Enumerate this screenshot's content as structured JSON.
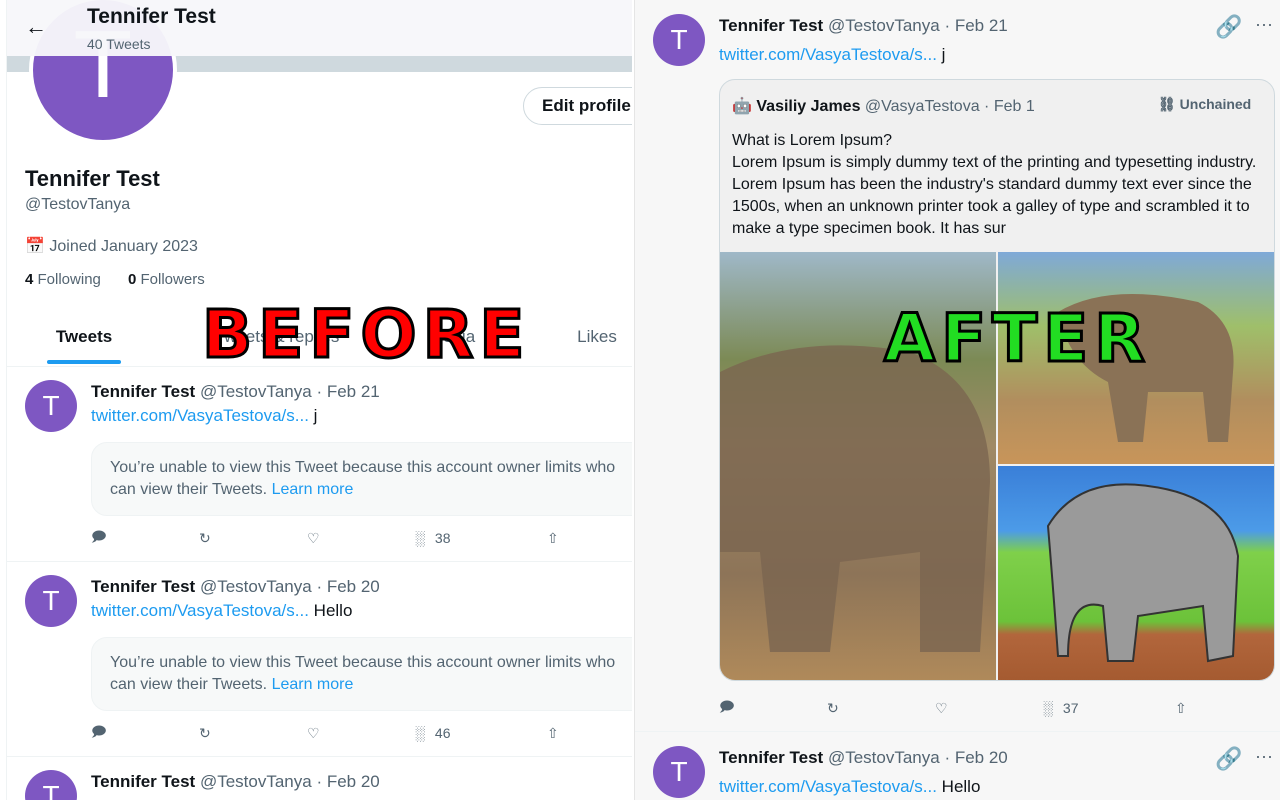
{
  "before": {
    "overlay_label": "BEFORE",
    "header": {
      "title": "Tennifer Test",
      "subtitle": "40 Tweets"
    },
    "profile": {
      "avatar_letter": "T",
      "name": "Tennifer Test",
      "handle": "@TestovTanya",
      "joined": "Joined January 2023",
      "following_count": "4",
      "following_label": "Following",
      "followers_count": "0",
      "followers_label": "Followers",
      "edit_button": "Edit profile"
    },
    "tabs": [
      {
        "label": "Tweets",
        "active": true
      },
      {
        "label": "Tweets & replies"
      },
      {
        "label": "Media"
      },
      {
        "label": "Likes"
      }
    ],
    "tweets": [
      {
        "name": "Tennifer Test",
        "handle": "@TestovTanya",
        "date": "· Feb 21",
        "link": "twitter.com/VasyaTestova/s...",
        "text": "j",
        "notice": "You’re unable to view this Tweet because this account owner limits who can view their Tweets.",
        "learn_more": "Learn more",
        "views": "38"
      },
      {
        "name": "Tennifer Test",
        "handle": "@TestovTanya",
        "date": "· Feb 20",
        "link": "twitter.com/VasyaTestova/s...",
        "text": "Hello",
        "notice": "You’re unable to view this Tweet because this account owner limits who can view their Tweets.",
        "learn_more": "Learn more",
        "views": "46"
      },
      {
        "name": "Tennifer Test",
        "handle": "@TestovTanya",
        "date": "· Feb 20"
      }
    ]
  },
  "after": {
    "overlay_label": "AFTER",
    "tweets": [
      {
        "avatar_letter": "T",
        "name": "Tennifer Test",
        "handle": "@TestovTanya",
        "date": "· Feb 21",
        "link": "twitter.com/VasyaTestova/s...",
        "text": "j",
        "views": "37",
        "quote": {
          "name": "Vasiliy James",
          "handle": "@VasyaTestova",
          "date": "· Feb 1",
          "badge": "Unchained",
          "text_title": "What is Lorem Ipsum?",
          "text": "Lorem Ipsum is simply dummy text of the printing and typesetting industry. Lorem Ipsum has been the industry's standard dummy text ever since the 1500s, when an unknown printer took a galley of type and scrambled it to make a type specimen book. It has sur"
        }
      },
      {
        "avatar_letter": "T",
        "name": "Tennifer Test",
        "handle": "@TestovTanya",
        "date": "· Feb 20",
        "link": "twitter.com/VasyaTestova/s...",
        "text": "Hello"
      }
    ]
  },
  "colors": {
    "accent": "#1d9bf0",
    "avatar": "#7e57c2",
    "before_overlay": "#ff0000",
    "after_overlay": "#22dd22"
  }
}
